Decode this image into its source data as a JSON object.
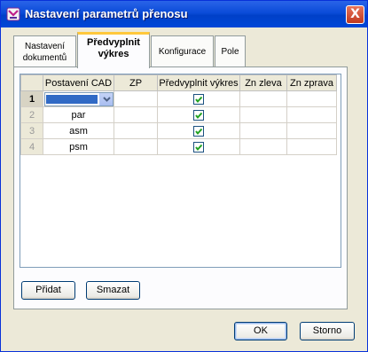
{
  "window": {
    "title": "Nastavení parametrů přenosu",
    "close_glyph": "X"
  },
  "tabs": [
    {
      "line1": "Nastavení",
      "line2": "dokumentů"
    },
    {
      "line1": "Předvyplnit",
      "line2": "výkres"
    },
    {
      "line1": "Konfigurace",
      "line2": ""
    },
    {
      "line1": "Pole",
      "line2": ""
    }
  ],
  "grid": {
    "columns": [
      "Postavení CAD",
      "ZP",
      "Předvyplnit výkres",
      "Zn zleva",
      "Zn zprava"
    ],
    "rows": [
      {
        "num": "1",
        "cad": "",
        "prefill": true
      },
      {
        "num": "2",
        "cad": "par",
        "prefill": true
      },
      {
        "num": "3",
        "cad": "asm",
        "prefill": true
      },
      {
        "num": "4",
        "cad": "psm",
        "prefill": true
      }
    ]
  },
  "buttons": {
    "add": "Přidat",
    "delete": "Smazat",
    "ok": "OK",
    "cancel": "Storno"
  }
}
